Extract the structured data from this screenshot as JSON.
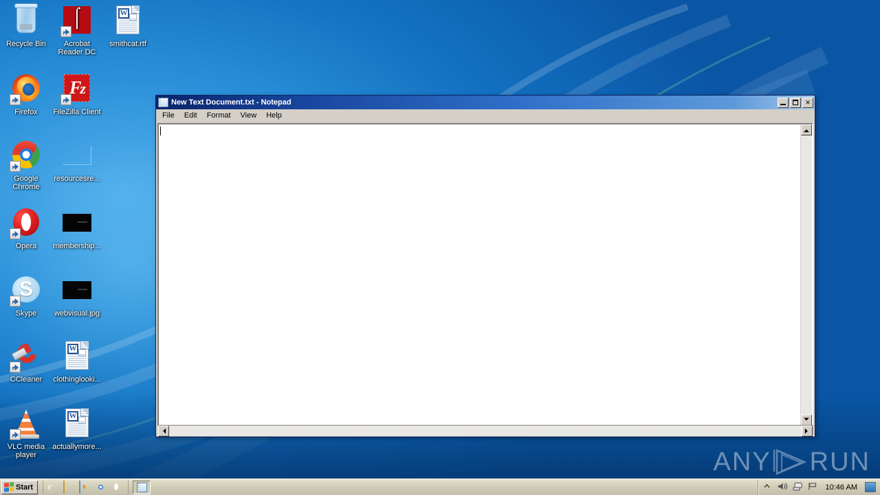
{
  "desktop": {
    "icons": [
      {
        "label": "Recycle Bin",
        "art": "recycle",
        "shortcut": false,
        "col": 0,
        "row": 0
      },
      {
        "label": "Acrobat\nReader DC",
        "art": "acrobat",
        "shortcut": true,
        "col": 1,
        "row": 0
      },
      {
        "label": "smithcat.rtf",
        "art": "doc",
        "shortcut": false,
        "col": 2,
        "row": 0
      },
      {
        "label": "Firefox",
        "art": "firefox",
        "shortcut": true,
        "col": 0,
        "row": 1
      },
      {
        "label": "FileZilla Client",
        "art": "filezilla",
        "shortcut": true,
        "col": 1,
        "row": 1
      },
      {
        "label": "Google\nChrome",
        "art": "chrome",
        "shortcut": true,
        "col": 0,
        "row": 2
      },
      {
        "label": "resourcesre...",
        "art": "faint",
        "shortcut": false,
        "col": 1,
        "row": 2
      },
      {
        "label": "Opera",
        "art": "opera",
        "shortcut": true,
        "col": 0,
        "row": 3
      },
      {
        "label": "membership...",
        "art": "black",
        "shortcut": false,
        "col": 1,
        "row": 3
      },
      {
        "label": "Skype",
        "art": "skype",
        "shortcut": true,
        "col": 0,
        "row": 4
      },
      {
        "label": "webvisual.jpg",
        "art": "black",
        "shortcut": false,
        "col": 1,
        "row": 4
      },
      {
        "label": "CCleaner",
        "art": "ccleaner",
        "shortcut": true,
        "col": 0,
        "row": 5
      },
      {
        "label": "clothinglooki...",
        "art": "doc",
        "shortcut": false,
        "col": 1,
        "row": 5
      },
      {
        "label": "VLC media\nplayer",
        "art": "vlc",
        "shortcut": true,
        "col": 0,
        "row": 6
      },
      {
        "label": "actuallymore...",
        "art": "doc",
        "shortcut": false,
        "col": 1,
        "row": 6
      }
    ]
  },
  "notepad": {
    "title": "New Text Document.txt - Notepad",
    "icon_name": "notepad-icon",
    "menu": [
      {
        "label": "File"
      },
      {
        "label": "Edit"
      },
      {
        "label": "Format"
      },
      {
        "label": "View"
      },
      {
        "label": "Help"
      }
    ],
    "window_buttons": {
      "minimize": "_",
      "maximize": "□",
      "close": "✕"
    },
    "text_content": "",
    "titlebar_color": "#0a246a",
    "face_color": "#d4d0c8"
  },
  "taskbar": {
    "start_label": "Start",
    "quick_launch": [
      {
        "name": "internet-explorer-icon"
      },
      {
        "name": "windows-explorer-icon"
      },
      {
        "name": "windows-media-player-icon"
      },
      {
        "name": "google-chrome-icon"
      },
      {
        "name": "opera-icon"
      }
    ],
    "task_buttons": [
      {
        "name": "notepad-task-button",
        "label": ""
      }
    ],
    "tray": {
      "show_hidden": "⌃",
      "volume": "volume-icon",
      "network": "network-icon",
      "action_center": "flag-icon",
      "time": "10:46 AM",
      "show_desktop": "show-desktop-button"
    }
  },
  "watermark": {
    "text_left": "ANY",
    "text_right": "RUN",
    "logo": "play-triangle-logo"
  }
}
